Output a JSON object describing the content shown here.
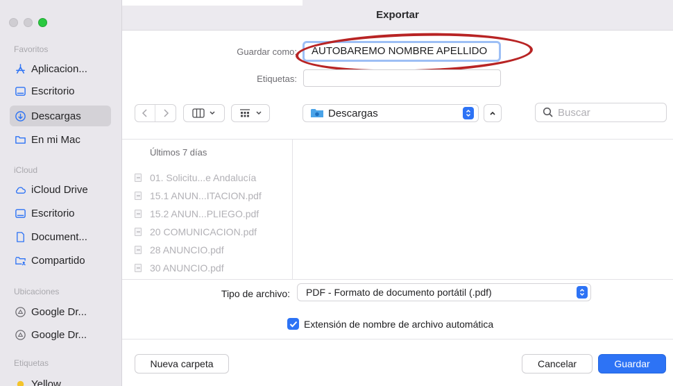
{
  "window": {
    "title": "Exportar"
  },
  "sidebar": {
    "sections": [
      {
        "title": "Favoritos",
        "items": [
          {
            "label": "Aplicacion...",
            "icon": "applications-icon"
          },
          {
            "label": "Escritorio",
            "icon": "desktop-icon"
          },
          {
            "label": "Descargas",
            "icon": "downloads-icon",
            "selected": true
          },
          {
            "label": "En mi Mac",
            "icon": "folder-icon"
          }
        ]
      },
      {
        "title": "iCloud",
        "items": [
          {
            "label": "iCloud Drive",
            "icon": "cloud-icon"
          },
          {
            "label": "Escritorio",
            "icon": "desktop-icon"
          },
          {
            "label": "Document...",
            "icon": "document-icon"
          },
          {
            "label": "Compartido",
            "icon": "shared-folder-icon"
          }
        ]
      },
      {
        "title": "Ubicaciones",
        "items": [
          {
            "label": "Google Dr...",
            "icon": "drive-icon"
          },
          {
            "label": "Google Dr...",
            "icon": "drive-icon"
          }
        ]
      },
      {
        "title": "Etiquetas",
        "items": [
          {
            "label": "Yellow",
            "icon": "yellow-tag-icon",
            "color": "#f4c42b"
          }
        ]
      }
    ]
  },
  "form": {
    "save_as_label": "Guardar como:",
    "save_as_value": "AUTOBAREMO NOMBRE APELLIDO",
    "tags_label": "Etiquetas:",
    "tags_value": ""
  },
  "toolbar": {
    "location": "Descargas",
    "search_placeholder": "Buscar"
  },
  "browser": {
    "column_header": "Últimos 7 días",
    "files": [
      "01. Solicitu...e Andalucía",
      "15.1 ANUN...ITACION.pdf",
      "15.2 ANUN...PLIEGO.pdf",
      "20 COMUNICACION.pdf",
      "28 ANUNCIO.pdf",
      "30 ANUNCIO.pdf"
    ]
  },
  "options": {
    "file_type_label": "Tipo de archivo:",
    "file_type_value": "PDF - Formato de documento portátil (.pdf)",
    "extension_label": "Extensión de nombre de archivo automática",
    "extension_checked": true
  },
  "buttons": {
    "new_folder": "Nueva carpeta",
    "cancel": "Cancelar",
    "save": "Guardar"
  },
  "colors": {
    "accent": "#2d73f5",
    "highlight_oval": "#b82424"
  }
}
